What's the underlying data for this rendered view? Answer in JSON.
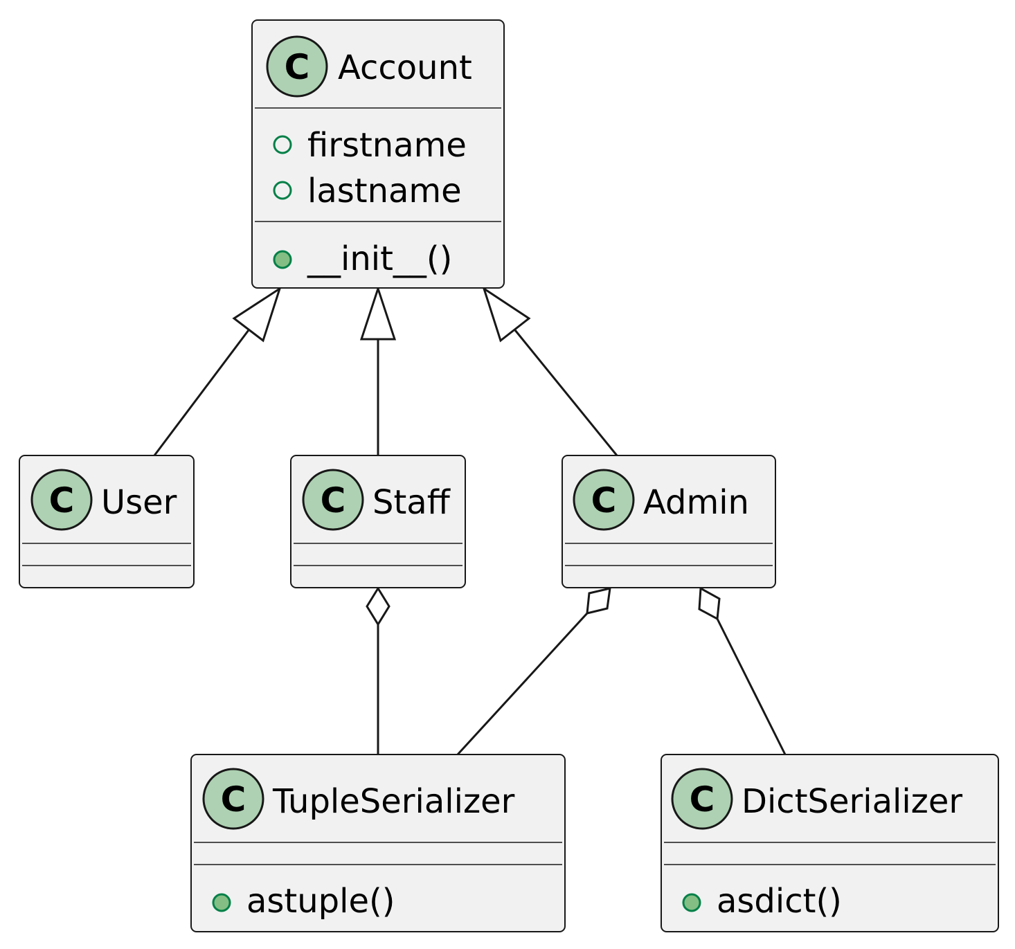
{
  "diagram": {
    "type": "uml-class-diagram",
    "colors": {
      "box_fill": "#f1f1f1",
      "border": "#181818",
      "badge_fill": "#add1b2",
      "visibility_public": "#038048",
      "method_dot_fill": "#84be84"
    },
    "classes": [
      {
        "id": "Account",
        "badge": "C",
        "name": "Account",
        "fields": [
          {
            "visibility": "public",
            "name": "firstname"
          },
          {
            "visibility": "public",
            "name": "lastname"
          }
        ],
        "methods": [
          {
            "visibility": "public",
            "name": "__init__()"
          }
        ]
      },
      {
        "id": "User",
        "badge": "C",
        "name": "User",
        "fields": [],
        "methods": []
      },
      {
        "id": "Staff",
        "badge": "C",
        "name": "Staff",
        "fields": [],
        "methods": []
      },
      {
        "id": "Admin",
        "badge": "C",
        "name": "Admin",
        "fields": [],
        "methods": []
      },
      {
        "id": "TupleSerializer",
        "badge": "C",
        "name": "TupleSerializer",
        "fields": [],
        "methods": [
          {
            "visibility": "public",
            "name": "astuple()"
          }
        ]
      },
      {
        "id": "DictSerializer",
        "badge": "C",
        "name": "DictSerializer",
        "fields": [],
        "methods": [
          {
            "visibility": "public",
            "name": "asdict()"
          }
        ]
      }
    ],
    "relations": [
      {
        "type": "inheritance",
        "from": "User",
        "to": "Account"
      },
      {
        "type": "inheritance",
        "from": "Staff",
        "to": "Account"
      },
      {
        "type": "inheritance",
        "from": "Admin",
        "to": "Account"
      },
      {
        "type": "aggregation",
        "whole": "Staff",
        "part": "TupleSerializer"
      },
      {
        "type": "aggregation",
        "whole": "Admin",
        "part": "TupleSerializer"
      },
      {
        "type": "aggregation",
        "whole": "Admin",
        "part": "DictSerializer"
      }
    ]
  }
}
